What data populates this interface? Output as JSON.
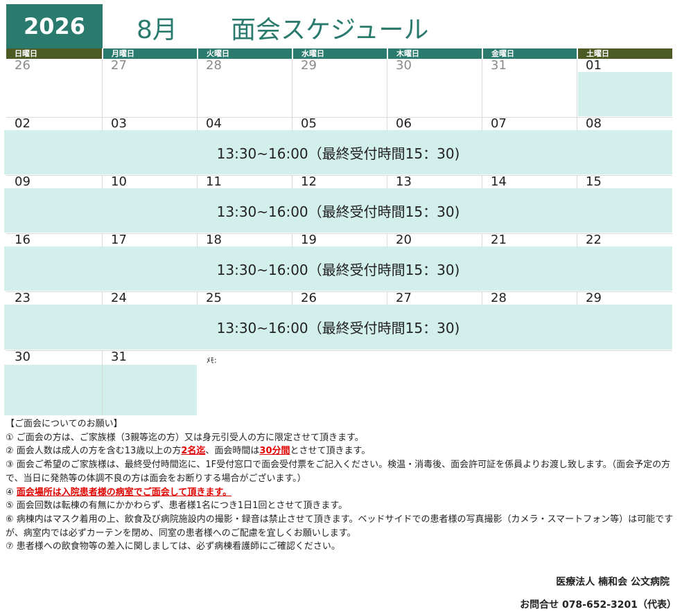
{
  "header": {
    "year": "2026",
    "month": "8月",
    "title": "面会スケジュール"
  },
  "weekdays": [
    "日曜日",
    "月曜日",
    "火曜日",
    "水曜日",
    "木曜日",
    "金曜日",
    "土曜日"
  ],
  "weeks": [
    [
      "26",
      "27",
      "28",
      "29",
      "30",
      "31",
      "01"
    ],
    [
      "02",
      "03",
      "04",
      "05",
      "06",
      "07",
      "08"
    ],
    [
      "09",
      "10",
      "11",
      "12",
      "13",
      "14",
      "15"
    ],
    [
      "16",
      "17",
      "18",
      "19",
      "20",
      "21",
      "22"
    ],
    [
      "23",
      "24",
      "25",
      "26",
      "27",
      "28",
      "29"
    ],
    [
      "30",
      "31"
    ]
  ],
  "visiting_hours": "13:30~16:00（最終受付時間15：30)",
  "memo_label": "ﾒﾓ:",
  "notes": {
    "heading": "【ご面会についてのお願い】",
    "n1": "①  ご面会の方は、ご家族様（3親等迄の方）又は身元引受人の方に限定させて頂きます。",
    "n2_pre": "②  面会人数は成人の方を含む13歳以上の方",
    "n2_red1": "2名迄",
    "n2_mid": "、面会時間は",
    "n2_red2": "30分間",
    "n2_post": "とさせて頂きます。",
    "n3": "③  面会ご希望のご家族様は、最終受付時間迄に、1F受付窓口で面会受付票をご記入ください。検温・消毒後、面会許可証を係員よりお渡し致します。（面会予定の方で、当日に発熱等の体調不良の方は面会をお断りする場合がございます。）",
    "n4_pre": "④  ",
    "n4_red": "面会場所は入院患者様の病室でご面会して頂きます。",
    "n5": "⑤  面会回数は転棟の有無にかかわらず、患者様1名につき1日1回とさせて頂きます。",
    "n6": "⑥  病棟内はマスク着用の上、飲食及び病院施設内の撮影・録音は禁止させて頂きます。ベッドサイドでの患者様の写真撮影（カメラ・スマートフォン等）は可能ですが、病室内では必ずカーテンを閉め、同室の患者様へのご配慮を宜しくお願いします。",
    "n7": "⑦  患者様への飲食物等の差入に関しましては、必ず病棟看護師にご確認ください。"
  },
  "footer": {
    "org": "医療法人  楠和会  公文病院",
    "contact": "お問合せ  078-652-3201（代表）"
  }
}
